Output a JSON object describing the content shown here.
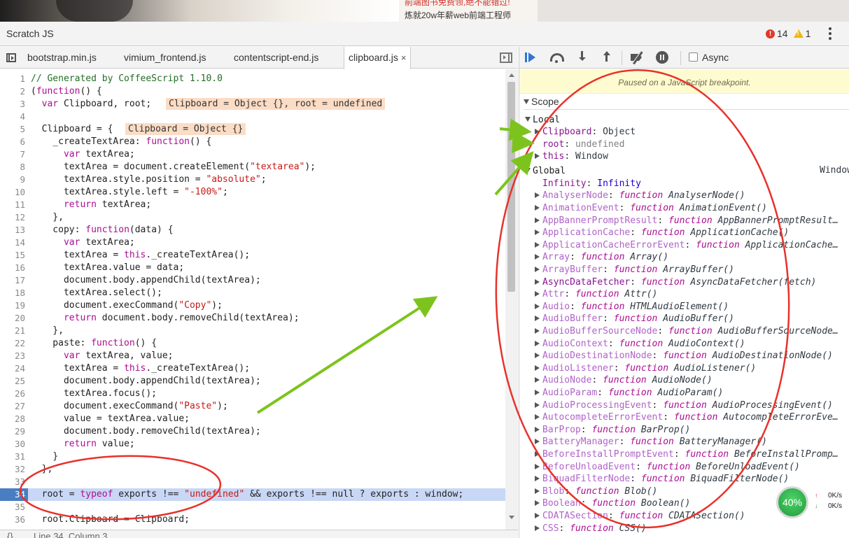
{
  "banner": {
    "line1": "前端图书免费领,绝不能错过!",
    "line2": "炼就20w年薪web前端工程师"
  },
  "devtools": {
    "title": "Scratch JS",
    "error_count": "14",
    "warning_count": "1",
    "error_icon": "!",
    "more_icon": "kebab-menu-icon"
  },
  "tabs": [
    {
      "label": "bootstrap.min.js",
      "active": false
    },
    {
      "label": "vimium_frontend.js",
      "active": false
    },
    {
      "label": "contentscript-end.js",
      "active": false
    },
    {
      "label": "clipboard.js",
      "active": true,
      "close": "×"
    }
  ],
  "editor": {
    "current_line": 34,
    "lines": [
      {
        "n": "1",
        "html": "<span class=\"cmt\">// Generated by CoffeeScript 1.10.0</span>"
      },
      {
        "n": "2",
        "html": "(<span class=\"kw\">function</span>() {"
      },
      {
        "n": "3",
        "html": "  <span class=\"kw\">var</span> Clipboard, root;"
      },
      {
        "n": "4",
        "html": ""
      },
      {
        "n": "5",
        "html": "  Clipboard = {"
      },
      {
        "n": "6",
        "html": "    _createTextArea: <span class=\"kw\">function</span>() {"
      },
      {
        "n": "7",
        "html": "      <span class=\"kw\">var</span> textArea;"
      },
      {
        "n": "8",
        "html": "      textArea = document.createElement(<span class=\"str\">\"textarea\"</span>);"
      },
      {
        "n": "9",
        "html": "      textArea.style.position = <span class=\"str\">\"absolute\"</span>;"
      },
      {
        "n": "10",
        "html": "      textArea.style.left = <span class=\"str\">\"-100%\"</span>;"
      },
      {
        "n": "11",
        "html": "      <span class=\"kw\">return</span> textArea;"
      },
      {
        "n": "12",
        "html": "    },"
      },
      {
        "n": "13",
        "html": "    copy: <span class=\"kw\">function</span>(data) {"
      },
      {
        "n": "14",
        "html": "      <span class=\"kw\">var</span> textArea;"
      },
      {
        "n": "15",
        "html": "      textArea = <span class=\"kw\">this</span>._createTextArea();"
      },
      {
        "n": "16",
        "html": "      textArea.value = data;"
      },
      {
        "n": "17",
        "html": "      document.body.appendChild(textArea);"
      },
      {
        "n": "18",
        "html": "      textArea.select();"
      },
      {
        "n": "19",
        "html": "      document.execCommand(<span class=\"str\">\"Copy\"</span>);"
      },
      {
        "n": "20",
        "html": "      <span class=\"kw\">return</span> document.body.removeChild(textArea);"
      },
      {
        "n": "21",
        "html": "    },"
      },
      {
        "n": "22",
        "html": "    paste: <span class=\"kw\">function</span>() {"
      },
      {
        "n": "23",
        "html": "      <span class=\"kw\">var</span> textArea, value;"
      },
      {
        "n": "24",
        "html": "      textArea = <span class=\"kw\">this</span>._createTextArea();"
      },
      {
        "n": "25",
        "html": "      document.body.appendChild(textArea);"
      },
      {
        "n": "26",
        "html": "      textArea.focus();"
      },
      {
        "n": "27",
        "html": "      document.execCommand(<span class=\"str\">\"Paste\"</span>);"
      },
      {
        "n": "28",
        "html": "      value = textArea.value;"
      },
      {
        "n": "29",
        "html": "      document.body.removeChild(textArea);"
      },
      {
        "n": "30",
        "html": "      <span class=\"kw\">return</span> value;"
      },
      {
        "n": "31",
        "html": "    }"
      },
      {
        "n": "32",
        "html": "  };"
      },
      {
        "n": "33",
        "html": ""
      },
      {
        "n": "34",
        "html": "  root = <span class=\"kw\">typeof</span> exports !== <span class=\"str\">\"undefined\"</span> &amp;&amp; exports !== null ? exports : window;"
      },
      {
        "n": "35",
        "html": ""
      },
      {
        "n": "36",
        "html": "  root.Clipboard = Clipboard;"
      }
    ],
    "inline_values": [
      {
        "line": 3,
        "text": "Clipboard = Object {}, root = undefined"
      },
      {
        "line": 5,
        "text": "Clipboard = Object {}"
      }
    ],
    "status": {
      "braces": "{}",
      "position": "Line 34, Column 3"
    }
  },
  "debugger": {
    "async_label": "Async",
    "async_checked": false,
    "paused_message": "Paused on a JavaScript breakpoint.",
    "scope_title": "Scope",
    "local_title": "Local",
    "global_title": "Global",
    "global_value": "Window",
    "local": [
      {
        "name": "Clipboard",
        "value": "Object",
        "expandable": true
      },
      {
        "name": "root",
        "value": "undefined",
        "expandable": false,
        "undef": true
      },
      {
        "name": "this",
        "value": "Window",
        "expandable": true
      }
    ],
    "global": [
      {
        "name": "Infinity",
        "value": "Infinity",
        "expandable": false,
        "num": true
      },
      {
        "name": "AnalyserNode",
        "value": "AnalyserNode()",
        "expandable": true,
        "fn": true
      },
      {
        "name": "AnimationEvent",
        "value": "AnimationEvent()",
        "expandable": true,
        "fn": true
      },
      {
        "name": "AppBannerPromptResult",
        "value": "AppBannerPromptResult…",
        "expandable": true,
        "fn": true
      },
      {
        "name": "ApplicationCache",
        "value": "ApplicationCache()",
        "expandable": true,
        "fn": true
      },
      {
        "name": "ApplicationCacheErrorEvent",
        "value": "ApplicationCache…",
        "expandable": true,
        "fn": true
      },
      {
        "name": "Array",
        "value": "Array()",
        "expandable": true,
        "fn": true
      },
      {
        "name": "ArrayBuffer",
        "value": "ArrayBuffer()",
        "expandable": true,
        "fn": true
      },
      {
        "name": "AsyncDataFetcher",
        "value": "AsyncDataFetcher(fetch)",
        "expandable": true,
        "fn": true,
        "strong": true
      },
      {
        "name": "Attr",
        "value": "Attr()",
        "expandable": true,
        "fn": true
      },
      {
        "name": "Audio",
        "value": "HTMLAudioElement()",
        "expandable": true,
        "fn": true
      },
      {
        "name": "AudioBuffer",
        "value": "AudioBuffer()",
        "expandable": true,
        "fn": true
      },
      {
        "name": "AudioBufferSourceNode",
        "value": "AudioBufferSourceNode…",
        "expandable": true,
        "fn": true
      },
      {
        "name": "AudioContext",
        "value": "AudioContext()",
        "expandable": true,
        "fn": true
      },
      {
        "name": "AudioDestinationNode",
        "value": "AudioDestinationNode()",
        "expandable": true,
        "fn": true
      },
      {
        "name": "AudioListener",
        "value": "AudioListener()",
        "expandable": true,
        "fn": true
      },
      {
        "name": "AudioNode",
        "value": "AudioNode()",
        "expandable": true,
        "fn": true
      },
      {
        "name": "AudioParam",
        "value": "AudioParam()",
        "expandable": true,
        "fn": true
      },
      {
        "name": "AudioProcessingEvent",
        "value": "AudioProcessingEvent()",
        "expandable": true,
        "fn": true
      },
      {
        "name": "AutocompleteErrorEvent",
        "value": "AutocompleteErrorEve…",
        "expandable": true,
        "fn": true
      },
      {
        "name": "BarProp",
        "value": "BarProp()",
        "expandable": true,
        "fn": true
      },
      {
        "name": "BatteryManager",
        "value": "BatteryManager()",
        "expandable": true,
        "fn": true
      },
      {
        "name": "BeforeInstallPromptEvent",
        "value": "BeforeInstallPromp…",
        "expandable": true,
        "fn": true
      },
      {
        "name": "BeforeUnloadEvent",
        "value": "BeforeUnloadEvent()",
        "expandable": true,
        "fn": true
      },
      {
        "name": "BiquadFilterNode",
        "value": "BiquadFilterNode()",
        "expandable": true,
        "fn": true
      },
      {
        "name": "Blob",
        "value": "Blob()",
        "expandable": true,
        "fn": true
      },
      {
        "name": "Boolean",
        "value": "Boolean()",
        "expandable": true,
        "fn": true
      },
      {
        "name": "CDATASection",
        "value": "CDATASection()",
        "expandable": true,
        "fn": true
      },
      {
        "name": "CSS",
        "value": "CSS()",
        "expandable": true,
        "fn": true
      }
    ],
    "fn_keyword": "function"
  },
  "network": {
    "percent": "40%",
    "up": "0K/s",
    "down": "0K/s",
    "up_arrow": "↑",
    "down_arrow": "↓"
  },
  "colors": {
    "annotation_red": "#e8312a",
    "annotation_green": "#7cc41d",
    "current_line_bg": "#c8d7f5",
    "gutter_current": "#4a7ec2"
  }
}
